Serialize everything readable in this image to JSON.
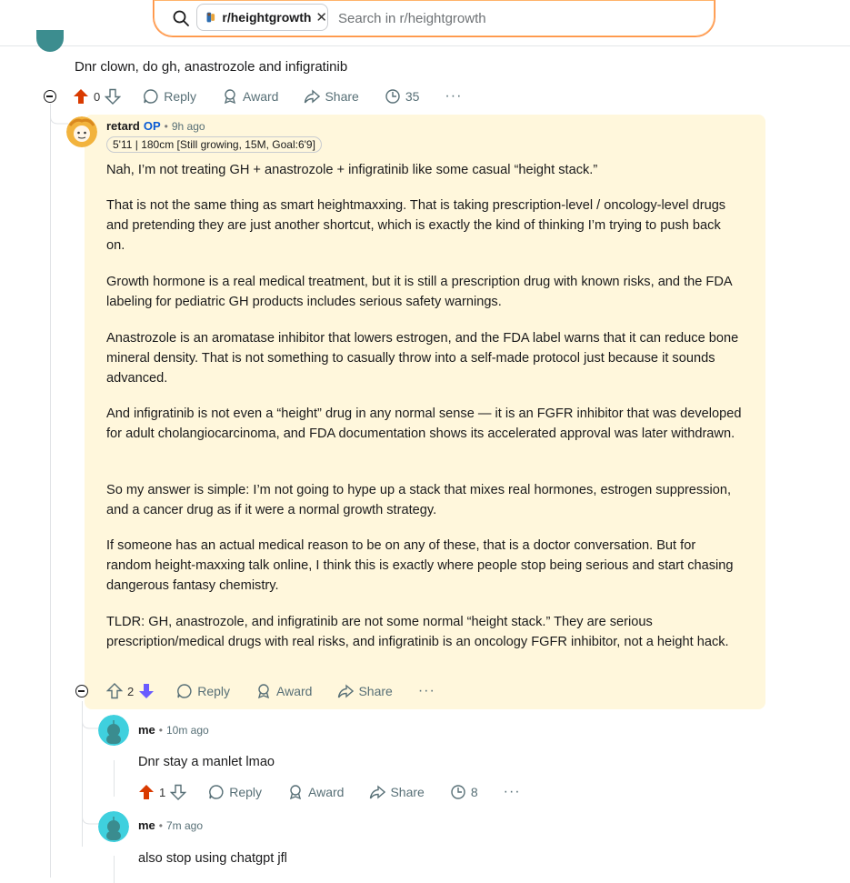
{
  "header": {
    "community_chip": "r/heightgrowth",
    "search_placeholder": "Search in r/heightgrowth",
    "accent_color": "#ff8a3d"
  },
  "comments": {
    "parent": {
      "text": "Dnr clown, do gh, anastrozole and infigratinib",
      "votes": "0",
      "reply": "Reply",
      "award": "Award",
      "share": "Share",
      "awards_count": "35"
    },
    "op": {
      "username": "retard",
      "op_badge": "OP",
      "time": "9h ago",
      "flair": "5'11 | 180cm [Still growing, 15M, Goal:6'9]",
      "paragraphs": [
        "Nah, I’m not treating GH + anastrozole + infigratinib like some casual “height stack.”",
        "That is not the same thing as smart heightmaxxing. That is taking prescription-level / oncology-level drugs and pretending they are just another shortcut, which is exactly the kind of thinking I’m trying to push back on.",
        "Growth hormone is a real medical treatment, but it is still a prescription drug with known risks, and the FDA labeling for pediatric GH products includes serious safety warnings.",
        "Anastrozole is an aromatase inhibitor that lowers estrogen, and the FDA label warns that it can reduce bone mineral density. That is not something to casually throw into a self-made protocol just because it sounds advanced.",
        "And infigratinib is not even a “height” drug in any normal sense — it is an FGFR inhibitor that was developed for adult cholangiocarcinoma, and FDA documentation shows its accelerated approval was later withdrawn.",
        "So my answer is simple: I’m not going to hype up a stack that mixes real hormones, estrogen suppression, and a cancer drug as if it were a normal growth strategy.",
        "If someone has an actual medical reason to be on any of these, that is a doctor conversation. But for random height-maxxing talk online, I think this is exactly where people stop being serious and start chasing dangerous fantasy chemistry.",
        "TLDR: GH, anastrozole, and infigratinib are not some normal “height stack.” They are serious prescription/medical drugs with real risks, and infigratinib is an oncology FGFR inhibitor, not a height hack."
      ],
      "votes": "2",
      "reply": "Reply",
      "award": "Award",
      "share": "Share"
    },
    "reply1": {
      "username": "me",
      "time": "10m ago",
      "text": "Dnr stay a manlet lmao",
      "votes": "1",
      "reply": "Reply",
      "award": "Award",
      "share": "Share",
      "awards_count": "8"
    },
    "reply2": {
      "username": "me",
      "time": "7m ago",
      "text": "also stop using chatgpt jfl"
    }
  },
  "colors": {
    "upvote": "#d93a00",
    "downvote_active": "#6a5cff",
    "highlight_bg": "#fff7dc",
    "op_blue": "#0a5bd4"
  }
}
